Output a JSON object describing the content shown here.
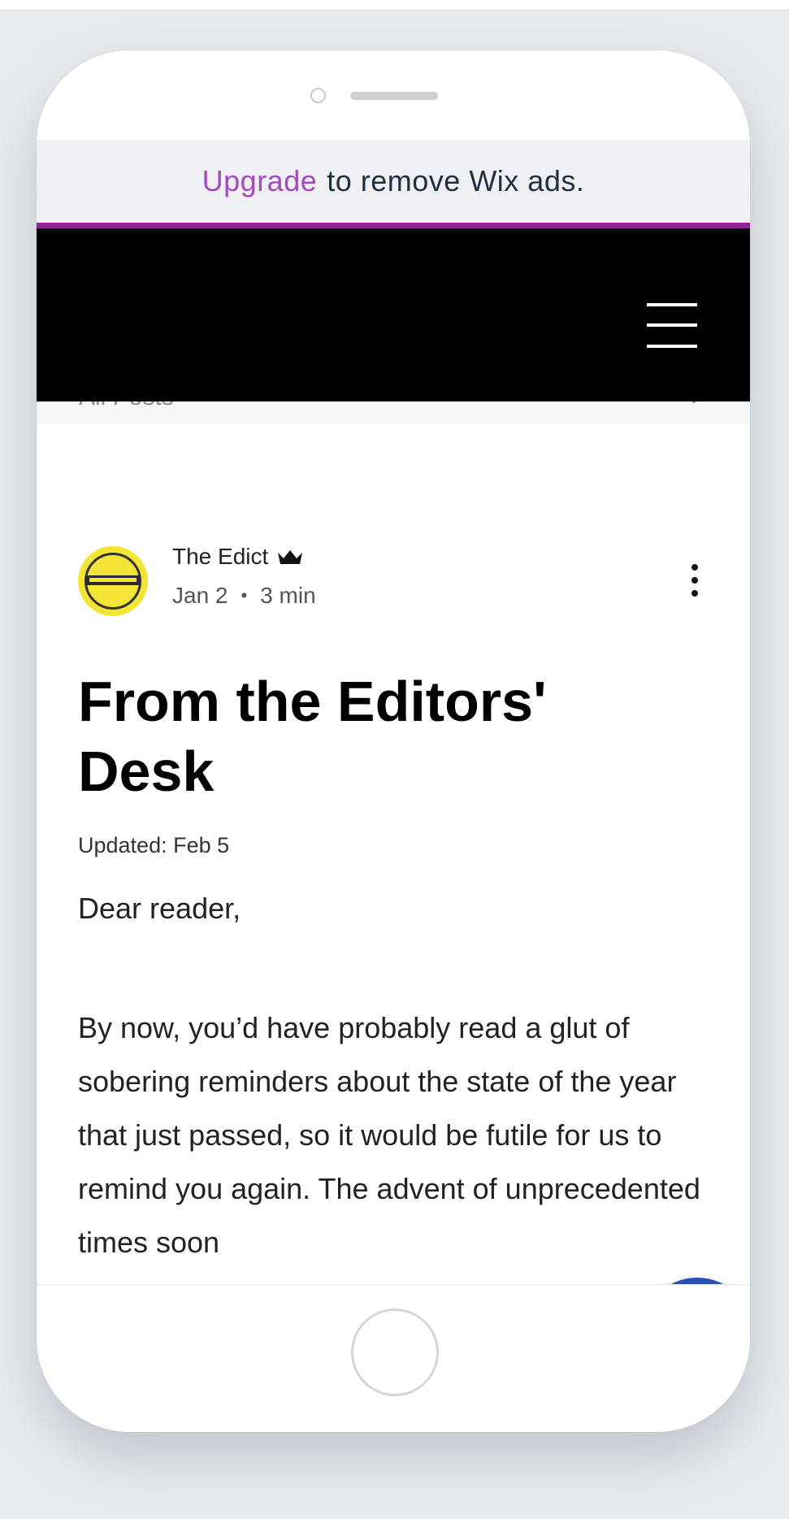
{
  "ad_banner": {
    "upgrade_label": "Upgrade",
    "rest_text": "to remove Wix ads."
  },
  "category_bar": {
    "label": "All Posts",
    "chevron": "⌄"
  },
  "post": {
    "author": "The Edict",
    "date": "Jan 2",
    "separator": "•",
    "read_time": "3 min",
    "title": "From the Editors' Desk",
    "updated": "Updated: Feb 5",
    "greeting": "Dear reader,",
    "body": "By now, you’d have probably read a glut of sobering reminders about the state of the year that just passed, so it would be futile for us to remind you again. The advent of unprecedented times soon"
  },
  "icons": {
    "menu": "hamburger-icon",
    "author_badge": "crown-icon",
    "more": "more-vertical-icon",
    "chat": "chat-icon"
  },
  "colors": {
    "upgrade": "#a24bbd",
    "ad_divider": "#9a1f9f",
    "header": "#000000",
    "chat_button": "#2a4fbd",
    "avatar": "#f3e436"
  }
}
